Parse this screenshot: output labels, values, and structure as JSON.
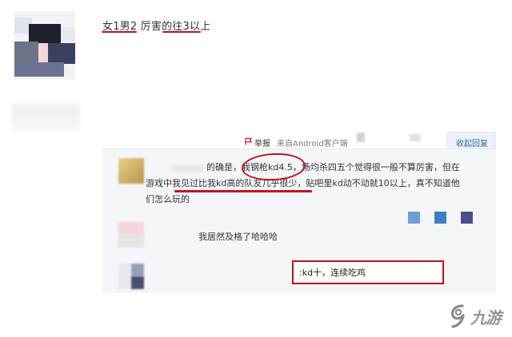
{
  "post": {
    "text_parts": [
      "女1",
      "男2",
      " 厉害的",
      "往3",
      "以上"
    ]
  },
  "action_bar": {
    "report_label": "举报",
    "source_label": "来自Android客户端",
    "reply_label": "收起回复"
  },
  "replies": [
    {
      "line1_prefix": "的确是，",
      "line1_circled": "我钢枪kd4.5",
      "line1_suffix": "，场均杀四五个觉得很一般不算厉害，但在",
      "line2_prefix": "游戏中",
      "line2_underlined": "我见过比我kd高的队友几乎很少",
      "line2_suffix": "，贴吧里kd动不动就10以上，真不知道他",
      "line3": "们怎么玩的"
    },
    {
      "text": "我居然及格了哈哈哈"
    },
    {
      "text": ":kd十，连续吃鸡"
    }
  ],
  "watermark": {
    "text": "九游",
    "logo_icon": "9game-logo-icon"
  },
  "colors": {
    "annotation_red": "#c0141c",
    "link_blue": "#2d64b3",
    "reply_bg": "#f4f6fa"
  }
}
